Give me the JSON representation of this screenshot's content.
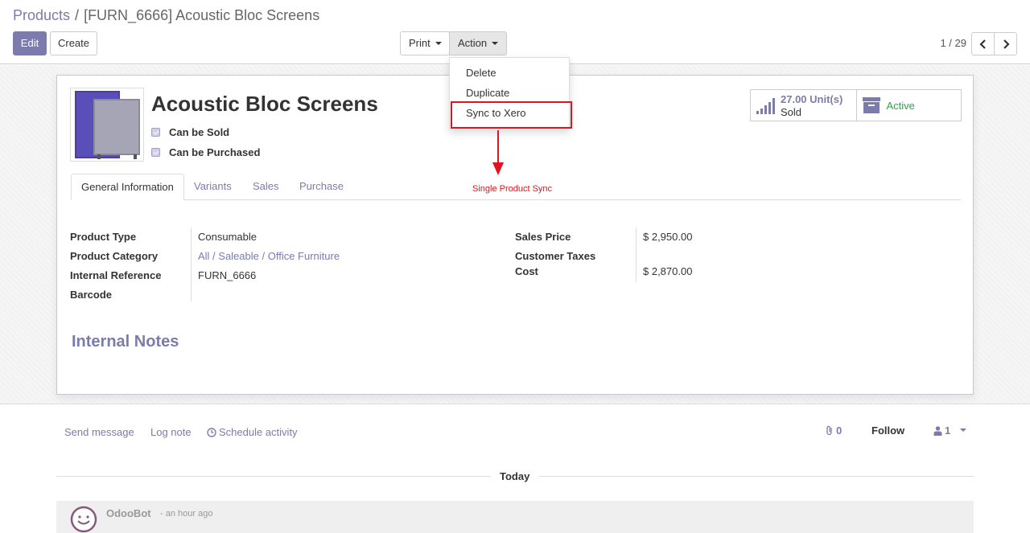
{
  "colors": {
    "primary": "#7c7bad",
    "annotation": "#e0141e",
    "active_status": "#28a745"
  },
  "breadcrumb": {
    "parent": "Products",
    "separator": "/",
    "current": "[FURN_6666] Acoustic Bloc Screens"
  },
  "toolbar": {
    "edit_label": "Edit",
    "create_label": "Create",
    "print_label": "Print",
    "action_label": "Action"
  },
  "pager": {
    "value": "1 / 29"
  },
  "action_menu": {
    "items": [
      {
        "label": "Delete"
      },
      {
        "label": "Duplicate"
      },
      {
        "label": "Sync to Xero"
      }
    ]
  },
  "annotation": {
    "label": "Single Product Sync"
  },
  "product": {
    "name": "Acoustic Bloc Screens",
    "can_be_sold_label": "Can be Sold",
    "can_be_purchased_label": "Can be Purchased",
    "can_be_sold": true,
    "can_be_purchased": true
  },
  "smart_buttons": {
    "sold_value": "27.00 Unit(s)",
    "sold_label": "Sold",
    "active_label": "Active"
  },
  "tabs": [
    {
      "label": "General Information",
      "active": true
    },
    {
      "label": "Variants"
    },
    {
      "label": "Sales"
    },
    {
      "label": "Purchase"
    }
  ],
  "fields": {
    "product_type": {
      "label": "Product Type",
      "value": "Consumable"
    },
    "product_category": {
      "label": "Product Category",
      "value": "All / Saleable / Office Furniture"
    },
    "internal_reference": {
      "label": "Internal Reference",
      "value": "FURN_6666"
    },
    "barcode": {
      "label": "Barcode",
      "value": ""
    },
    "sales_price": {
      "label": "Sales Price",
      "value": "$ 2,950.00"
    },
    "customer_taxes": {
      "label": "Customer Taxes",
      "value": ""
    },
    "cost": {
      "label": "Cost",
      "value": "$ 2,870.00"
    }
  },
  "internal_notes": {
    "title": "Internal Notes"
  },
  "chatter": {
    "send_message": "Send message",
    "log_note": "Log note",
    "schedule_activity": "Schedule activity",
    "attachments_count": "0",
    "follow_label": "Follow",
    "followers_count": "1",
    "today_label": "Today",
    "message_author": "OdooBot",
    "message_time": "- an hour ago"
  }
}
